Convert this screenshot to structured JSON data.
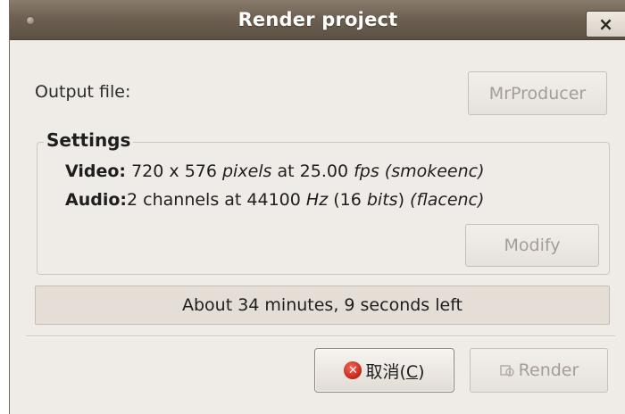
{
  "window": {
    "title": "Render project",
    "close_glyph": "×"
  },
  "output": {
    "label": "Output file:",
    "file_button_label": "MrProducer"
  },
  "settings": {
    "legend": "Settings",
    "video": {
      "label": "Video:",
      "width": "720",
      "sep": "x",
      "height": "576",
      "pixels_unit": "pixels",
      "at": "at",
      "fps": "25.00",
      "fps_unit": "fps",
      "encoder": "(smokeenc)"
    },
    "audio": {
      "label": "Audio:",
      "channels": "2",
      "channels_word": "channels",
      "at": "at",
      "rate": "44100",
      "rate_unit": "Hz",
      "bits_open": "(16",
      "bits_unit": "bits",
      "bits_close": ")",
      "encoder": "(flacenc)"
    },
    "modify_label": "Modify"
  },
  "progress": {
    "text": "About 34 minutes, 9 seconds left"
  },
  "buttons": {
    "cancel_label_main": "取消(",
    "cancel_mnemonic": "C",
    "cancel_label_end": ")",
    "render_label": "Render"
  },
  "icons": {
    "cancel": "cancel-circle-icon",
    "render": "render-gear-icon"
  }
}
